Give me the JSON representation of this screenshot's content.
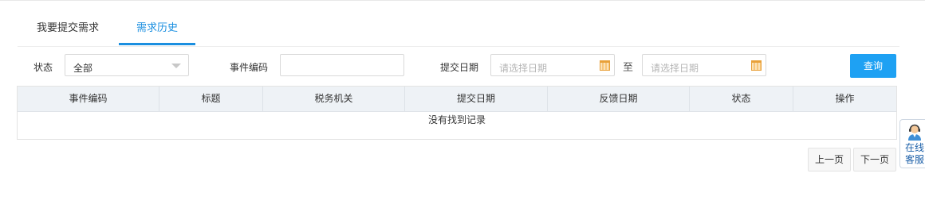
{
  "tabs": [
    {
      "label": "我要提交需求",
      "active": false
    },
    {
      "label": "需求历史",
      "active": true
    }
  ],
  "filters": {
    "status_label": "状态",
    "status_value": "全部",
    "event_code_label": "事件编码",
    "event_code_value": "",
    "submit_date_label": "提交日期",
    "date_from_placeholder": "请选择日期",
    "range_separator": "至",
    "date_to_placeholder": "请选择日期",
    "query_button": "查询"
  },
  "table": {
    "columns": [
      "事件编码",
      "标题",
      "税务机关",
      "提交日期",
      "反馈日期",
      "状态",
      "操作"
    ],
    "empty_text": "没有找到记录"
  },
  "pager": {
    "prev": "上一页",
    "next": "下一页"
  },
  "service_widget": {
    "line1": "在线",
    "line2": "客服",
    "icon": "customer-service-icon"
  },
  "colors": {
    "accent": "#1b8fe0",
    "button": "#1ea1f3",
    "header_bg": "#eef2f6",
    "calendar_icon": "#f0a030"
  }
}
